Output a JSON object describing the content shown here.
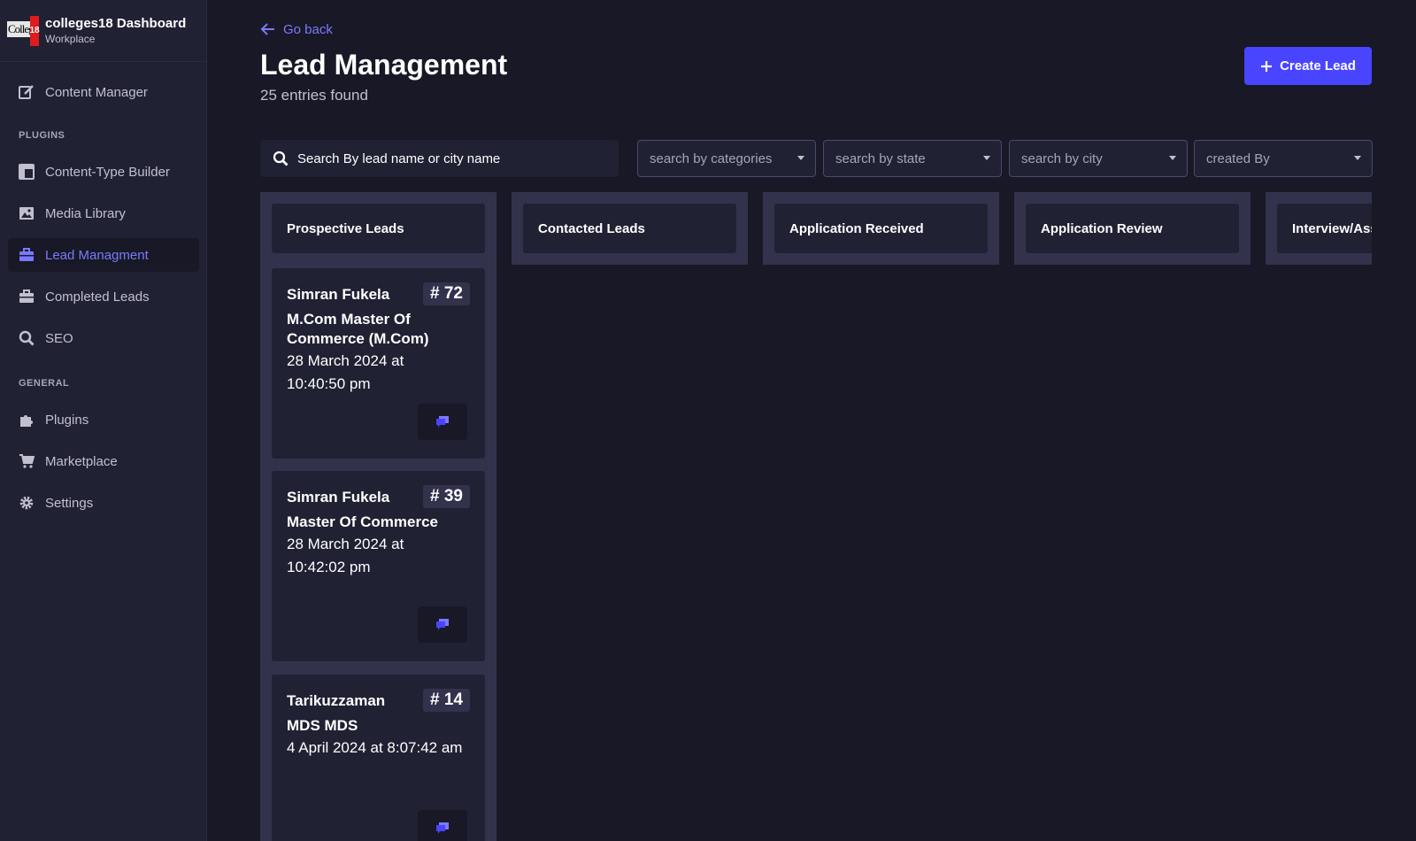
{
  "app": {
    "title": "colleges18 Dashboard",
    "subtitle": "Workplace",
    "logo_text": "College",
    "logo_num": "18"
  },
  "sidebar": {
    "items": [
      {
        "label": "Content Manager",
        "icon": "edit-icon"
      },
      {
        "label": "Content-Type Builder",
        "icon": "layout-icon"
      },
      {
        "label": "Media Library",
        "icon": "image-icon"
      },
      {
        "label": "Lead Managment",
        "icon": "briefcase-icon",
        "active": true
      },
      {
        "label": "Completed Leads",
        "icon": "briefcase-icon"
      },
      {
        "label": "SEO",
        "icon": "search-icon"
      },
      {
        "label": "Plugins",
        "icon": "puzzle-icon"
      },
      {
        "label": "Marketplace",
        "icon": "cart-icon"
      },
      {
        "label": "Settings",
        "icon": "gear-icon"
      }
    ],
    "sections": {
      "plugins": "PLUGINS",
      "general": "GENERAL"
    }
  },
  "header": {
    "go_back": "Go back",
    "title": "Lead Management",
    "entries": "25 entries found",
    "create_button": "Create Lead"
  },
  "filters": {
    "search_placeholder": "Search By lead name or city name",
    "categories": "search by categories",
    "state": "search by state",
    "city": "search by city",
    "created_by": "created By"
  },
  "board": {
    "columns": [
      {
        "title": "Prospective Leads"
      },
      {
        "title": "Contacted Leads"
      },
      {
        "title": "Application Received"
      },
      {
        "title": "Application Review"
      },
      {
        "title": "Interview/Assessment"
      }
    ],
    "cards": [
      {
        "name": "Simran Fukela",
        "id": "# 72",
        "course": "M.Com Master Of Commerce (M.Com)",
        "date": "28 March 2024 at 10:40:50 pm"
      },
      {
        "name": "Simran Fukela",
        "id": "# 39",
        "course": "Master Of Commerce",
        "date": "28 March 2024 at 10:42:02 pm"
      },
      {
        "name": "Tarikuzzaman",
        "id": "# 14",
        "course": "MDS MDS",
        "date": "4 April 2024 at 8:07:42 am"
      }
    ]
  },
  "colors": {
    "accent": "#4945ff",
    "accent_text": "#7b79ff",
    "background": "#181826",
    "panel": "#212134",
    "column": "#32324d"
  }
}
